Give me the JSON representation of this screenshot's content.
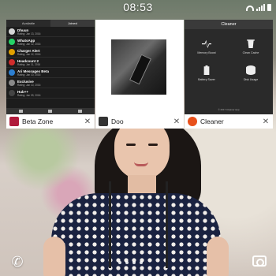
{
  "status_bar": {
    "time": "08:53"
  },
  "frames": [
    {
      "label": "Beta Zone",
      "tabs": [
        "Available",
        "Joined"
      ],
      "rows": [
        {
          "title": "Dhuun",
          "sub": "Rating: Jan 13, 2016",
          "color": "#d6d6d6"
        },
        {
          "title": "WhatsApp",
          "sub": "Rating: Jan 12, 2016",
          "color": "#25d366"
        },
        {
          "title": "Charger Alert",
          "sub": "Rating: Jan 12, 2016",
          "color": "#e0a000"
        },
        {
          "title": "Headcount 2",
          "sub": "Rating: Jan 11, 2016",
          "color": "#d12d2d"
        },
        {
          "title": "Ari Messages Beta",
          "sub": "Rating: Jan 10, 2016",
          "color": "#2d7fd1"
        },
        {
          "title": "Exclusive",
          "sub": "Rating: Jan 10, 2016",
          "color": "#888888"
        },
        {
          "title": "Hub++",
          "sub": "Rating: Jan 09, 2016",
          "color": "#444444"
        }
      ],
      "icon_color": "#b01a3b"
    },
    {
      "label": "Doo",
      "icon_color": "#333333"
    },
    {
      "label": "Cleaner",
      "header": "Cleaner",
      "tiles": [
        "Memory Boost",
        "Clean Cache",
        "Battery Saver",
        "Disk Usage"
      ],
      "footer": "© 2017 Cleaner App",
      "icon_color": "#e8501a"
    }
  ],
  "close_glyph": "✕",
  "bottom": {
    "phone_icon": "phone-icon",
    "camera_icon": "camera-icon",
    "page_count": 4
  }
}
